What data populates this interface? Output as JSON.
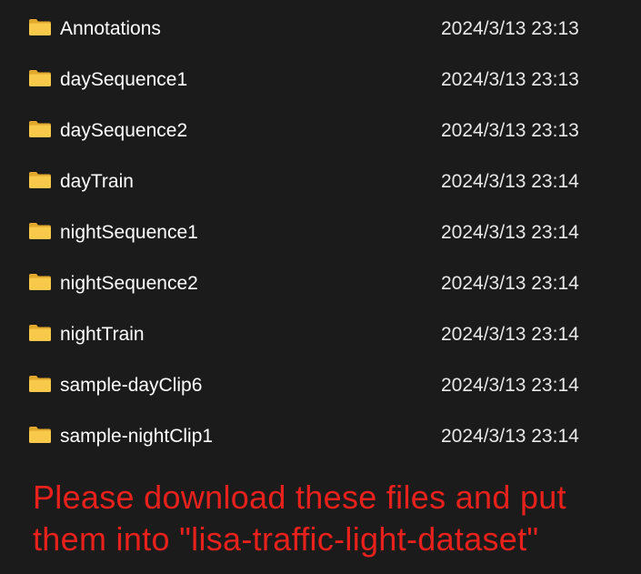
{
  "files": [
    {
      "name": "Annotations",
      "modified": "2024/3/13 23:13",
      "icon": "folder-icon"
    },
    {
      "name": "daySequence1",
      "modified": "2024/3/13 23:13",
      "icon": "folder-icon"
    },
    {
      "name": "daySequence2",
      "modified": "2024/3/13 23:13",
      "icon": "folder-icon"
    },
    {
      "name": "dayTrain",
      "modified": "2024/3/13 23:14",
      "icon": "folder-icon"
    },
    {
      "name": "nightSequence1",
      "modified": "2024/3/13 23:14",
      "icon": "folder-icon"
    },
    {
      "name": "nightSequence2",
      "modified": "2024/3/13 23:14",
      "icon": "folder-icon"
    },
    {
      "name": "nightTrain",
      "modified": "2024/3/13 23:14",
      "icon": "folder-icon"
    },
    {
      "name": "sample-dayClip6",
      "modified": "2024/3/13 23:14",
      "icon": "folder-icon"
    },
    {
      "name": "sample-nightClip1",
      "modified": "2024/3/13 23:14",
      "icon": "folder-icon"
    }
  ],
  "notice": {
    "line1": "Please download these files and put",
    "line2": "them into \"lisa-traffic-light-dataset\""
  },
  "colors": {
    "background": "#1b1b1b",
    "folder_front": "#f8c94a",
    "folder_back": "#e0a82e",
    "notice_text": "#e8211c"
  }
}
